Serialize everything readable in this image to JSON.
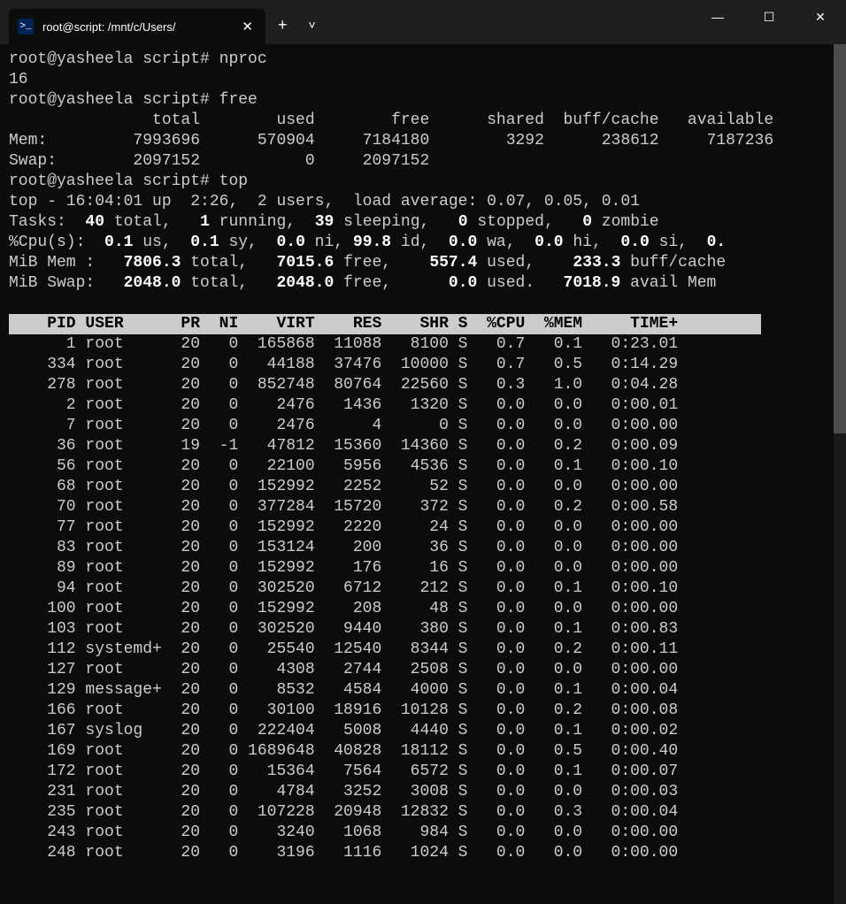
{
  "window": {
    "tab_title": "root@script: /mnt/c/Users/",
    "newtab": "+",
    "dropdown": "˅",
    "min": "—",
    "max": "☐",
    "close": "✕"
  },
  "prompt": "root@yasheela script#",
  "cmd_nproc": "nproc",
  "nproc_out": "16",
  "cmd_free": "free",
  "free_header": "               total        used        free      shared  buff/cache   available",
  "free_mem": "Mem:         7993696      570904     7184180        3292      238612     7187236",
  "free_swap": "Swap:        2097152           0     2097152",
  "cmd_top": "top",
  "top_line": "top - 16:04:01 up  2:26,  2 users,  load average: 0.07, 0.05, 0.01",
  "tasks_line": {
    "prefix": "Tasks:  ",
    "v1": "40",
    "t1": " total,   ",
    "v2": "1",
    "t2": " running,  ",
    "v3": "39",
    "t3": " sleeping,   ",
    "v4": "0",
    "t4": " stopped,   ",
    "v5": "0",
    "t5": " zombie"
  },
  "cpu_line": {
    "prefix": "%Cpu(s):  ",
    "v1": "0.1",
    "t1": " us,  ",
    "v2": "0.1",
    "t2": " sy,  ",
    "v3": "0.0",
    "t3": " ni, ",
    "v4": "99.8",
    "t4": " id,  ",
    "v5": "0.0",
    "t5": " wa,  ",
    "v6": "0.0",
    "t6": " hi,  ",
    "v7": "0.0",
    "t7": " si,  ",
    "v8": "0."
  },
  "mem_line": {
    "prefix": "MiB Mem :   ",
    "v1": "7806.3",
    "t1": " total,   ",
    "v2": "7015.6",
    "t2": " free,    ",
    "v3": "557.4",
    "t3": " used,    ",
    "v4": "233.3",
    "t4": " buff/cache"
  },
  "swap_line": {
    "prefix": "MiB Swap:   ",
    "v1": "2048.0",
    "t1": " total,   ",
    "v2": "2048.0",
    "t2": " free,      ",
    "v3": "0.0",
    "t3": " used.   ",
    "v4": "7018.9",
    "t4": " avail Mem"
  },
  "proc_header": "    PID USER      PR  NI    VIRT    RES    SHR S  %CPU  %MEM     TIME+ ",
  "procs": [
    {
      "pid": "1",
      "user": "root",
      "pr": "20",
      "ni": "0",
      "virt": "165868",
      "res": "11088",
      "shr": "8100",
      "s": "S",
      "cpu": "0.7",
      "mem": "0.1",
      "time": "0:23.01"
    },
    {
      "pid": "334",
      "user": "root",
      "pr": "20",
      "ni": "0",
      "virt": "44188",
      "res": "37476",
      "shr": "10000",
      "s": "S",
      "cpu": "0.7",
      "mem": "0.5",
      "time": "0:14.29"
    },
    {
      "pid": "278",
      "user": "root",
      "pr": "20",
      "ni": "0",
      "virt": "852748",
      "res": "80764",
      "shr": "22560",
      "s": "S",
      "cpu": "0.3",
      "mem": "1.0",
      "time": "0:04.28"
    },
    {
      "pid": "2",
      "user": "root",
      "pr": "20",
      "ni": "0",
      "virt": "2476",
      "res": "1436",
      "shr": "1320",
      "s": "S",
      "cpu": "0.0",
      "mem": "0.0",
      "time": "0:00.01"
    },
    {
      "pid": "7",
      "user": "root",
      "pr": "20",
      "ni": "0",
      "virt": "2476",
      "res": "4",
      "shr": "0",
      "s": "S",
      "cpu": "0.0",
      "mem": "0.0",
      "time": "0:00.00"
    },
    {
      "pid": "36",
      "user": "root",
      "pr": "19",
      "ni": "-1",
      "virt": "47812",
      "res": "15360",
      "shr": "14360",
      "s": "S",
      "cpu": "0.0",
      "mem": "0.2",
      "time": "0:00.09"
    },
    {
      "pid": "56",
      "user": "root",
      "pr": "20",
      "ni": "0",
      "virt": "22100",
      "res": "5956",
      "shr": "4536",
      "s": "S",
      "cpu": "0.0",
      "mem": "0.1",
      "time": "0:00.10"
    },
    {
      "pid": "68",
      "user": "root",
      "pr": "20",
      "ni": "0",
      "virt": "152992",
      "res": "2252",
      "shr": "52",
      "s": "S",
      "cpu": "0.0",
      "mem": "0.0",
      "time": "0:00.00"
    },
    {
      "pid": "70",
      "user": "root",
      "pr": "20",
      "ni": "0",
      "virt": "377284",
      "res": "15720",
      "shr": "372",
      "s": "S",
      "cpu": "0.0",
      "mem": "0.2",
      "time": "0:00.58"
    },
    {
      "pid": "77",
      "user": "root",
      "pr": "20",
      "ni": "0",
      "virt": "152992",
      "res": "2220",
      "shr": "24",
      "s": "S",
      "cpu": "0.0",
      "mem": "0.0",
      "time": "0:00.00"
    },
    {
      "pid": "83",
      "user": "root",
      "pr": "20",
      "ni": "0",
      "virt": "153124",
      "res": "200",
      "shr": "36",
      "s": "S",
      "cpu": "0.0",
      "mem": "0.0",
      "time": "0:00.00"
    },
    {
      "pid": "89",
      "user": "root",
      "pr": "20",
      "ni": "0",
      "virt": "152992",
      "res": "176",
      "shr": "16",
      "s": "S",
      "cpu": "0.0",
      "mem": "0.0",
      "time": "0:00.00"
    },
    {
      "pid": "94",
      "user": "root",
      "pr": "20",
      "ni": "0",
      "virt": "302520",
      "res": "6712",
      "shr": "212",
      "s": "S",
      "cpu": "0.0",
      "mem": "0.1",
      "time": "0:00.10"
    },
    {
      "pid": "100",
      "user": "root",
      "pr": "20",
      "ni": "0",
      "virt": "152992",
      "res": "208",
      "shr": "48",
      "s": "S",
      "cpu": "0.0",
      "mem": "0.0",
      "time": "0:00.00"
    },
    {
      "pid": "103",
      "user": "root",
      "pr": "20",
      "ni": "0",
      "virt": "302520",
      "res": "9440",
      "shr": "380",
      "s": "S",
      "cpu": "0.0",
      "mem": "0.1",
      "time": "0:00.83"
    },
    {
      "pid": "112",
      "user": "systemd+",
      "pr": "20",
      "ni": "0",
      "virt": "25540",
      "res": "12540",
      "shr": "8344",
      "s": "S",
      "cpu": "0.0",
      "mem": "0.2",
      "time": "0:00.11"
    },
    {
      "pid": "127",
      "user": "root",
      "pr": "20",
      "ni": "0",
      "virt": "4308",
      "res": "2744",
      "shr": "2508",
      "s": "S",
      "cpu": "0.0",
      "mem": "0.0",
      "time": "0:00.00"
    },
    {
      "pid": "129",
      "user": "message+",
      "pr": "20",
      "ni": "0",
      "virt": "8532",
      "res": "4584",
      "shr": "4000",
      "s": "S",
      "cpu": "0.0",
      "mem": "0.1",
      "time": "0:00.04"
    },
    {
      "pid": "166",
      "user": "root",
      "pr": "20",
      "ni": "0",
      "virt": "30100",
      "res": "18916",
      "shr": "10128",
      "s": "S",
      "cpu": "0.0",
      "mem": "0.2",
      "time": "0:00.08"
    },
    {
      "pid": "167",
      "user": "syslog",
      "pr": "20",
      "ni": "0",
      "virt": "222404",
      "res": "5008",
      "shr": "4440",
      "s": "S",
      "cpu": "0.0",
      "mem": "0.1",
      "time": "0:00.02"
    },
    {
      "pid": "169",
      "user": "root",
      "pr": "20",
      "ni": "0",
      "virt": "1689648",
      "res": "40828",
      "shr": "18112",
      "s": "S",
      "cpu": "0.0",
      "mem": "0.5",
      "time": "0:00.40"
    },
    {
      "pid": "172",
      "user": "root",
      "pr": "20",
      "ni": "0",
      "virt": "15364",
      "res": "7564",
      "shr": "6572",
      "s": "S",
      "cpu": "0.0",
      "mem": "0.1",
      "time": "0:00.07"
    },
    {
      "pid": "231",
      "user": "root",
      "pr": "20",
      "ni": "0",
      "virt": "4784",
      "res": "3252",
      "shr": "3008",
      "s": "S",
      "cpu": "0.0",
      "mem": "0.0",
      "time": "0:00.03"
    },
    {
      "pid": "235",
      "user": "root",
      "pr": "20",
      "ni": "0",
      "virt": "107228",
      "res": "20948",
      "shr": "12832",
      "s": "S",
      "cpu": "0.0",
      "mem": "0.3",
      "time": "0:00.04"
    },
    {
      "pid": "243",
      "user": "root",
      "pr": "20",
      "ni": "0",
      "virt": "3240",
      "res": "1068",
      "shr": "984",
      "s": "S",
      "cpu": "0.0",
      "mem": "0.0",
      "time": "0:00.00"
    },
    {
      "pid": "248",
      "user": "root",
      "pr": "20",
      "ni": "0",
      "virt": "3196",
      "res": "1116",
      "shr": "1024",
      "s": "S",
      "cpu": "0.0",
      "mem": "0.0",
      "time": "0:00.00"
    }
  ]
}
